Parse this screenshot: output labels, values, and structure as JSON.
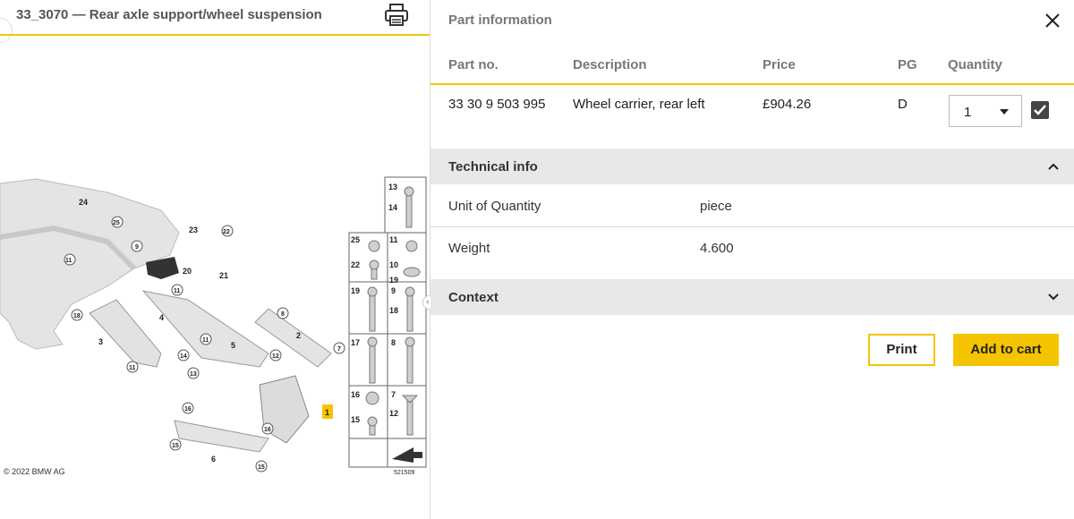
{
  "diagram_panel": {
    "title": "33_3070 — Rear axle support/wheel suspension",
    "copyright": "© 2022 BMW AG",
    "image_number": "521509",
    "callouts": [
      "24",
      "25",
      "23",
      "22",
      "9",
      "10",
      "11",
      "20",
      "21",
      "22",
      "11",
      "19",
      "17",
      "4",
      "18",
      "3",
      "11",
      "14",
      "5",
      "13",
      "12",
      "8",
      "2",
      "7",
      "1",
      "16",
      "15",
      "6",
      "16",
      "15"
    ],
    "parts_box_numbers": [
      "13",
      "14",
      "25",
      "11",
      "22",
      "10",
      "19",
      "19",
      "9",
      "18",
      "17",
      "8",
      "16",
      "7",
      "12",
      "15"
    ]
  },
  "part_panel": {
    "title": "Part information",
    "columns": {
      "part_no": "Part no.",
      "description": "Description",
      "price": "Price",
      "pg": "PG",
      "quantity": "Quantity"
    },
    "row": {
      "part_no": "33 30 9 503 995",
      "description": "Wheel carrier, rear left",
      "price": "£904.26",
      "pg": "D",
      "quantity": "1",
      "selected": true
    },
    "technical_info": {
      "label": "Technical info",
      "expanded": true,
      "items": [
        {
          "label": "Unit of Quantity",
          "value": "piece"
        },
        {
          "label": "Weight",
          "value": "4.600"
        }
      ]
    },
    "context": {
      "label": "Context",
      "expanded": false
    },
    "buttons": {
      "print": "Print",
      "add_to_cart": "Add to cart"
    }
  },
  "colors": {
    "accent": "#f5c400",
    "section_bg": "#e8e8e8",
    "checkbox": "#444444"
  },
  "icons": {
    "print": "printer-icon",
    "close": "close-icon",
    "expand_up": "chevron-up-icon",
    "expand_down": "chevron-down-icon",
    "resize": "resize-handle-icon"
  }
}
